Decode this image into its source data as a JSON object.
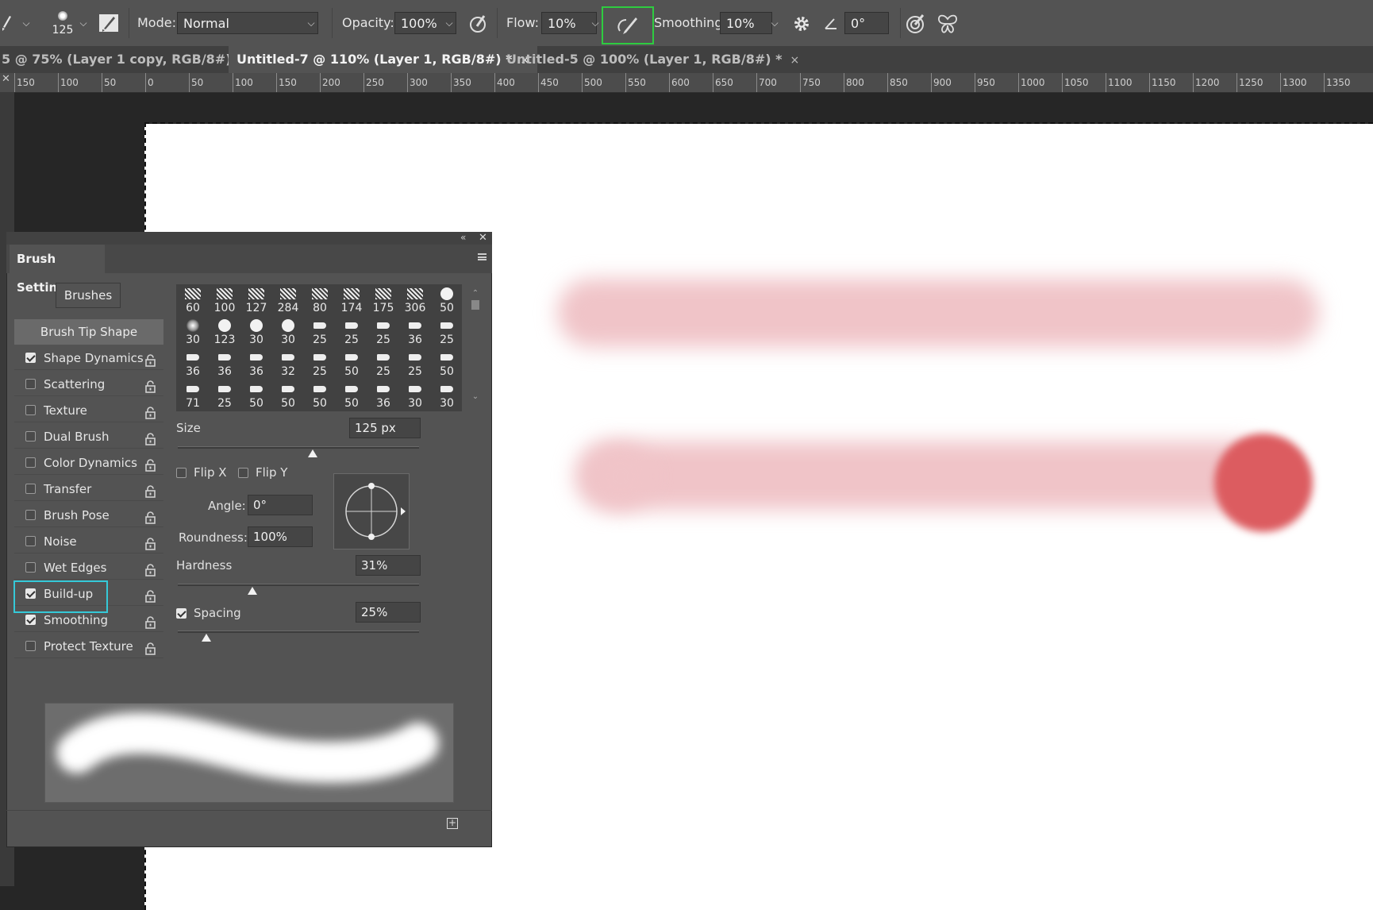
{
  "options_bar": {
    "brush_size": "125",
    "mode_label": "Mode:",
    "mode_value": "Normal",
    "opacity_label": "Opacity:",
    "opacity_value": "100%",
    "flow_label": "Flow:",
    "flow_value": "10%",
    "smoothing_label": "Smoothing:",
    "smoothing_value": "10%",
    "angle_value": "0°",
    "airbrush_highlight": "#2ecc40"
  },
  "tabs": [
    {
      "title": "5 @ 75% (Layer 1 copy, RGB/8#) *",
      "close": "×"
    },
    {
      "title": "Untitled-7 @ 110% (Layer 1, RGB/8#) *",
      "close": "×"
    },
    {
      "title": "Untitled-5 @ 100% (Layer 1, RGB/8#) *",
      "close": "×"
    }
  ],
  "ruler": {
    "labels": [
      "150",
      "100",
      "50",
      "0",
      "50",
      "100",
      "150",
      "200",
      "250",
      "300",
      "350",
      "400",
      "450",
      "500",
      "550",
      "600",
      "650",
      "700",
      "750",
      "800",
      "850",
      "900",
      "950",
      "1000",
      "1050",
      "1100",
      "1150",
      "1200",
      "1250",
      "1300",
      "1350"
    ]
  },
  "panel": {
    "title": "Brush Settings",
    "brushes_button": "Brushes",
    "tip_shape_button": "Brush Tip Shape",
    "options": [
      {
        "label": "Shape Dynamics",
        "checked": true
      },
      {
        "label": "Scattering",
        "checked": false
      },
      {
        "label": "Texture",
        "checked": false
      },
      {
        "label": "Dual Brush",
        "checked": false
      },
      {
        "label": "Color Dynamics",
        "checked": false
      },
      {
        "label": "Transfer",
        "checked": false
      },
      {
        "label": "Brush Pose",
        "checked": false
      },
      {
        "label": "Noise",
        "checked": false
      },
      {
        "label": "Wet Edges",
        "checked": false
      },
      {
        "label": "Build-up",
        "checked": true
      },
      {
        "label": "Smoothing",
        "checked": true
      },
      {
        "label": "Protect Texture",
        "checked": false
      }
    ],
    "buildup_highlight": "#35c9d8",
    "tip_sizes": [
      [
        "60",
        "100",
        "127",
        "284",
        "80",
        "174",
        "175",
        "306",
        "50"
      ],
      [
        "30",
        "123",
        "30",
        "30",
        "25",
        "25",
        "25",
        "36",
        "25"
      ],
      [
        "36",
        "36",
        "36",
        "32",
        "25",
        "50",
        "25",
        "25",
        "50"
      ],
      [
        "71",
        "25",
        "50",
        "50",
        "50",
        "50",
        "36",
        "30",
        "30"
      ]
    ],
    "size_label": "Size",
    "size_value": "125 px",
    "size_fraction": 0.56,
    "flip_x": "Flip X",
    "flip_y": "Flip Y",
    "angle_label": "Angle:",
    "angle_value": "0°",
    "roundness_label": "Roundness:",
    "roundness_value": "100%",
    "hardness_label": "Hardness",
    "hardness_value": "31%",
    "hardness_fraction": 0.31,
    "spacing_label": "Spacing",
    "spacing_value": "25%",
    "spacing_fraction": 0.12
  },
  "colors": {
    "stroke_soft": "#f0c4c8",
    "stroke_hard": "#dc5c60"
  }
}
